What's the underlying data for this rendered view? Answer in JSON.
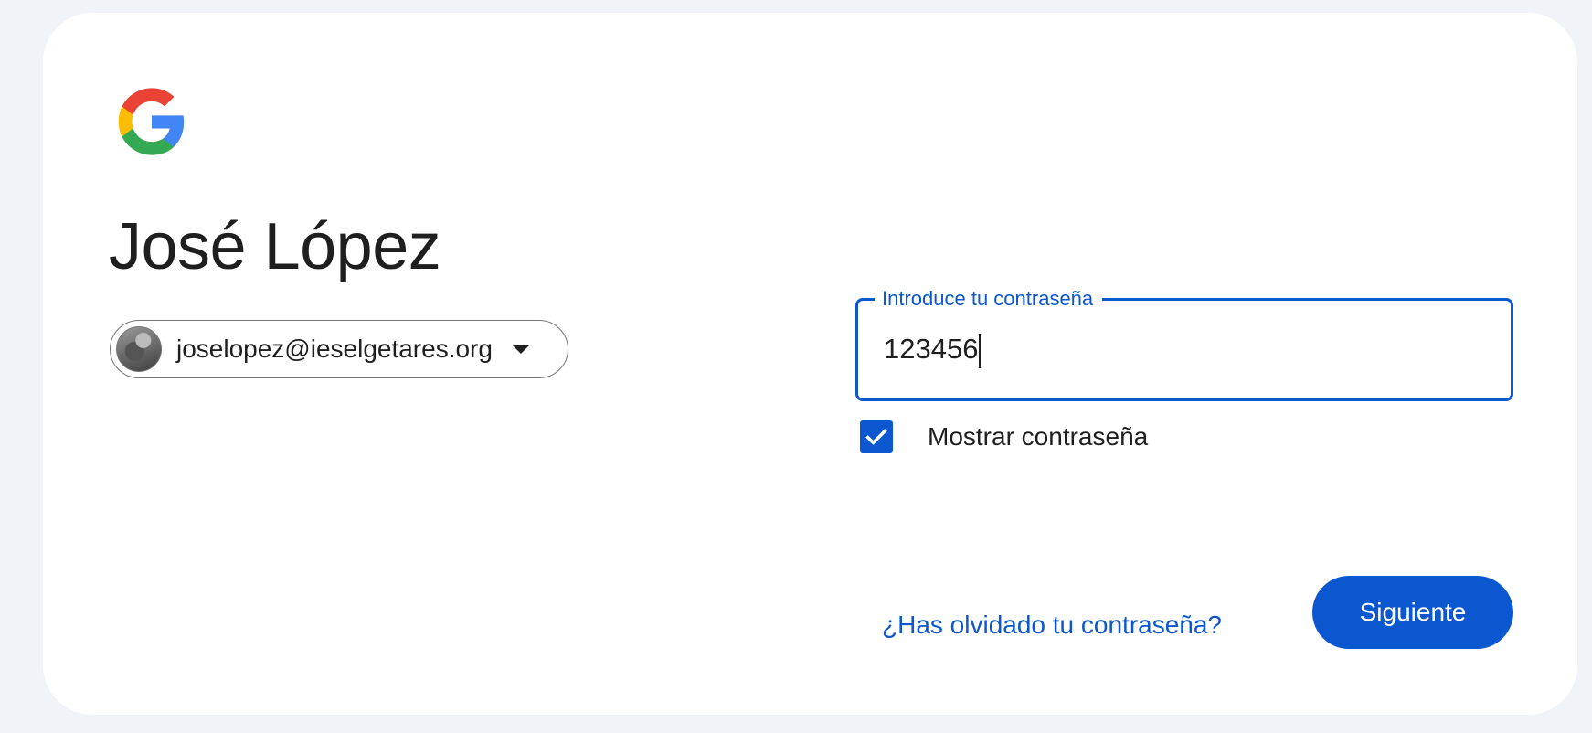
{
  "brand": {
    "logo_icon": "google-g-logo-icon",
    "colors": {
      "red": "#ea4335",
      "yellow": "#fbbc05",
      "green": "#34a853",
      "blue": "#4285f4"
    }
  },
  "user": {
    "name": "José López",
    "email": "joselopez@ieselgetares.org",
    "avatar_icon": "user-avatar-photo",
    "dropdown_icon": "caret-down-icon"
  },
  "password": {
    "label": "Introduce tu contraseña",
    "value": "123456"
  },
  "show_password": {
    "label": "Mostrar contraseña",
    "checked": true,
    "icon": "checkmark-icon"
  },
  "actions": {
    "forgot_label": "¿Has olvidado tu contraseña?",
    "next_label": "Siguiente"
  },
  "colors": {
    "accent": "#0b57d0",
    "background": "#f0f4f9",
    "card": "#ffffff"
  }
}
